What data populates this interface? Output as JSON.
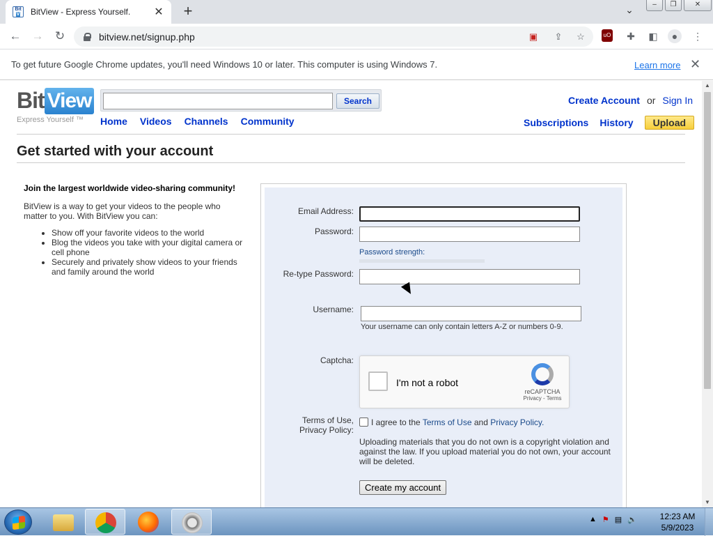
{
  "browser": {
    "tab_title": "BitView - Express Yourself.",
    "url": "bitview.net/signup.php",
    "infobar_text": "To get future Google Chrome updates, you'll need Windows 10 or later. This computer is using Windows 7.",
    "infobar_link": "Learn more"
  },
  "site": {
    "logo_bit": "Bit",
    "logo_view": "View",
    "tagline": "Express Yourself ™",
    "search_button": "Search",
    "nav": [
      "Home",
      "Videos",
      "Channels",
      "Community"
    ],
    "create_account": "Create Account",
    "or": "or",
    "sign_in": "Sign In",
    "subnav": [
      "Subscriptions",
      "History"
    ],
    "upload": "Upload"
  },
  "page": {
    "title": "Get started with your account",
    "left_heading": "Join the largest worldwide video-sharing community!",
    "left_intro": "BitView is a way to get your videos to the people who matter to you. With BitView you can:",
    "bullets": [
      "Show off your favorite videos to the world",
      "Blog the videos you take with your digital camera or cell phone",
      "Securely and privately show videos to your friends and family around the world"
    ]
  },
  "form": {
    "email_label": "Email Address:",
    "password_label": "Password:",
    "password_strength": "Password strength:",
    "retype_label": "Re-type Password:",
    "username_label": "Username:",
    "username_hint": "Your username can only contain letters A-Z or numbers 0-9.",
    "captcha_label": "Captcha:",
    "captcha_text": "I'm not a robot",
    "captcha_brand": "reCAPTCHA",
    "captcha_links": "Privacy - Terms",
    "terms_label_1": "Terms of Use,",
    "terms_label_2": "Privacy Policy:",
    "agree_prefix": "I agree to the",
    "terms_link": "Terms of Use",
    "and": "and",
    "privacy_link": "Privacy Policy.",
    "warning": "Uploading materials that you do not own is a copyright violation and against the law. If you upload material you do not own, your account will be deleted.",
    "submit": "Create my account"
  },
  "taskbar": {
    "time": "12:23 AM",
    "date": "5/9/2023"
  },
  "colors": {
    "link": "#0033cc",
    "panel_bg": "#e9eef8",
    "upload_bg": "#f7cf3b"
  }
}
